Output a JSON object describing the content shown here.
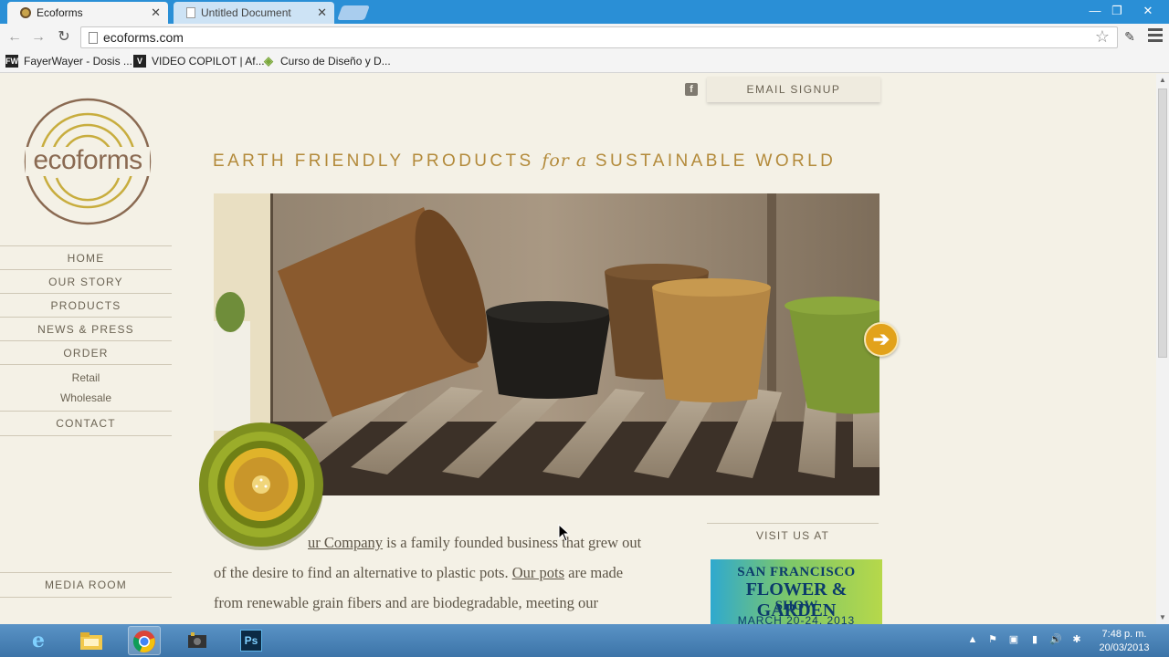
{
  "browser": {
    "tabs": [
      {
        "label": "Ecoforms",
        "active": true
      },
      {
        "label": "Untitled Document",
        "active": false
      }
    ],
    "url": "ecoforms.com",
    "bookmarks": [
      {
        "label": "FayerWayer - Dosis ...",
        "icon": "FW"
      },
      {
        "label": "VIDEO COPILOT | Af...",
        "icon": "V"
      },
      {
        "label": "Curso de Diseño y D...",
        "icon": "diamond"
      }
    ]
  },
  "site": {
    "logo_text": "ecoforms",
    "nav": [
      {
        "label": "HOME"
      },
      {
        "label": "OUR STORY"
      },
      {
        "label": "PRODUCTS"
      },
      {
        "label": "NEWS & PRESS"
      },
      {
        "label": "ORDER"
      }
    ],
    "order_sub": [
      "Retail",
      "Wholesale"
    ],
    "contact": "CONTACT",
    "media_room": "MEDIA ROOM",
    "email_signup": "EMAIL SIGNUP",
    "tagline": {
      "part1": "EARTH FRIENDLY PRODUCTS ",
      "italic": "for a",
      "part2": " SUSTAINABLE WORLD"
    },
    "body": {
      "link1": "ur Company",
      "text1": " is a family founded business that grew out",
      "text2": "of the desire to find an alternative to plastic pots. ",
      "link2": "Our pots",
      "text3": " are made",
      "text4": "from renewable grain fibers and are biodegradable, meeting our"
    },
    "visit_us": "VISIT US AT",
    "show_banner": {
      "line1": "SAN FRANCISCO",
      "line2": "FLOWER & GARDEN",
      "line3": "SHOW",
      "line4": "MARCH 20-24, 2013"
    },
    "colors": {
      "background": "#f4f1e6",
      "tagline_gold": "#b38a3a",
      "arrow_orange": "#e2a21a"
    }
  },
  "taskbar": {
    "apps": [
      "ie-icon",
      "explorer-icon",
      "chrome-icon",
      "video-app-icon",
      "photoshop-icon"
    ],
    "photoshop_label": "Ps",
    "time": "7:48 p. m.",
    "date": "20/03/2013"
  }
}
